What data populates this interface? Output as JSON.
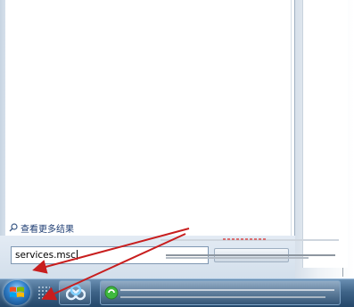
{
  "start_menu": {
    "see_more_label": "查看更多结果",
    "search_value": "services.msc"
  },
  "taskbar": {
    "pinned": [
      "start-orb",
      "baidu-cloud-app",
      "green-app"
    ]
  },
  "icons": {
    "see_more": "search-icon",
    "shutdown": "power-icon"
  },
  "colors": {
    "annotation_arrow": "#c81e1e",
    "taskbar": "#2f5478",
    "link_text": "#1e3d73"
  }
}
